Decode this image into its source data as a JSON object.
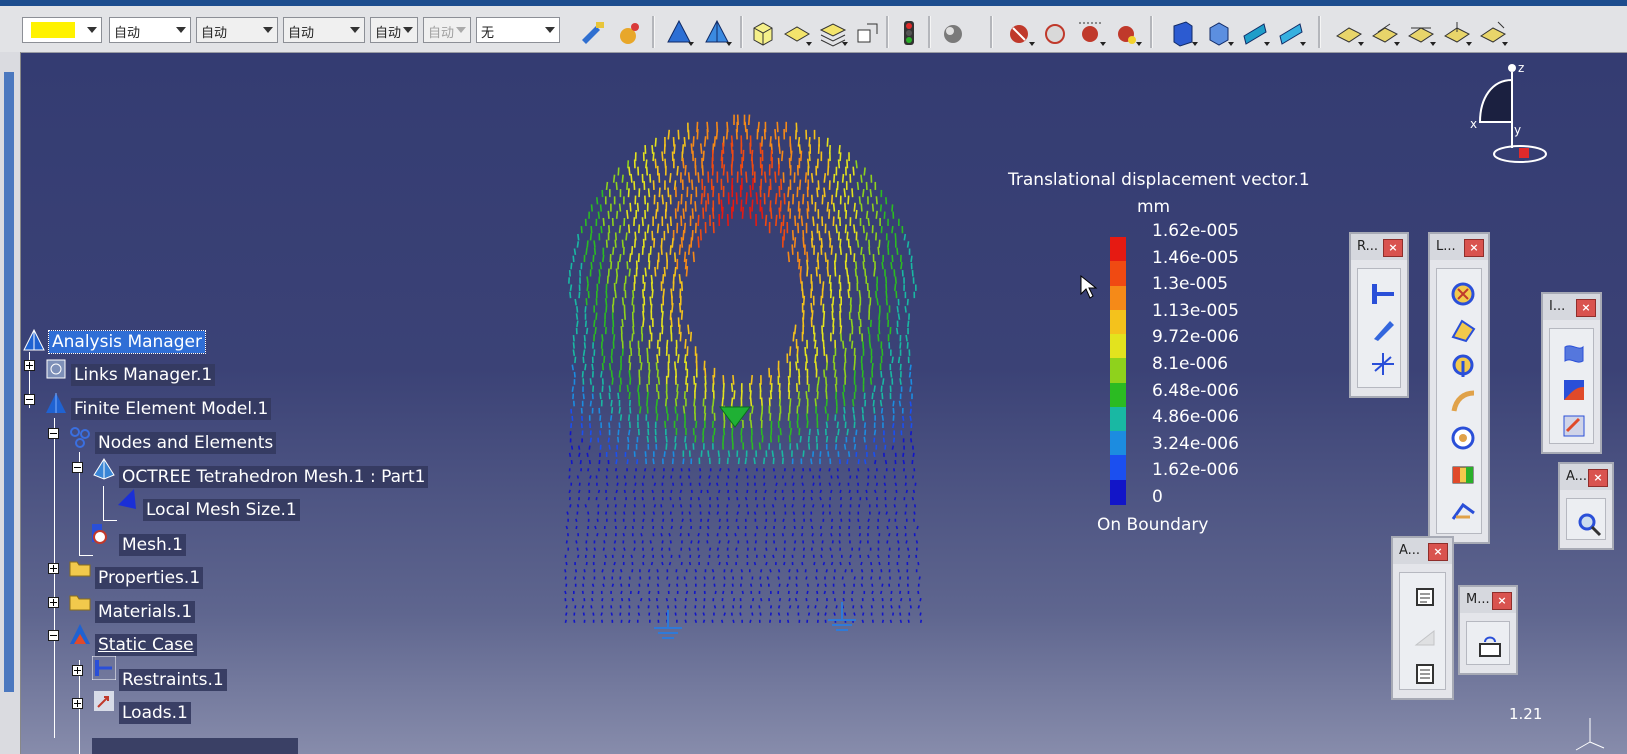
{
  "toolbar": {
    "combos": [
      {
        "label": "自动"
      },
      {
        "label": "自动"
      },
      {
        "label": "自动"
      },
      {
        "label": "自动"
      },
      {
        "label": "自动"
      },
      {
        "label": "无"
      }
    ],
    "color_swatch": "#fff200"
  },
  "tree": {
    "items": [
      {
        "label": "Analysis Manager"
      },
      {
        "label": "Links Manager.1"
      },
      {
        "label": "Finite Element Model.1"
      },
      {
        "label": "Nodes and Elements"
      },
      {
        "label": "OCTREE Tetrahedron Mesh.1 : Part1"
      },
      {
        "label": "Local Mesh Size.1"
      },
      {
        "label": "Mesh.1"
      },
      {
        "label": "Properties.1"
      },
      {
        "label": "Materials.1"
      },
      {
        "label": "Static Case"
      },
      {
        "label": "Restraints.1"
      },
      {
        "label": "Loads.1"
      }
    ]
  },
  "legend": {
    "title": "Translational displacement vector.1",
    "unit": "mm",
    "values": [
      "1.62e-005",
      "1.46e-005",
      "1.3e-005",
      "1.13e-005",
      "9.72e-006",
      "8.1e-006",
      "6.48e-006",
      "4.86e-006",
      "3.24e-006",
      "1.62e-006",
      "0"
    ],
    "colors": [
      "#e61a12",
      "#f04a12",
      "#f58a18",
      "#f4c21c",
      "#e3e31e",
      "#8fd21c",
      "#2bbb22",
      "#19b8a3",
      "#1c8ce0",
      "#1b4ff0",
      "#1215c8"
    ],
    "footer": "On Boundary"
  },
  "floating_toolbars": [
    {
      "title": "R...",
      "close": "×"
    },
    {
      "title": "L...",
      "close": "×"
    },
    {
      "title": "I...",
      "close": "×"
    },
    {
      "title": "A...",
      "close": "×"
    },
    {
      "title": "A...",
      "close": "×"
    },
    {
      "title": "M...",
      "close": "×"
    }
  ],
  "compass": {
    "z": "z",
    "x": "x",
    "y": "y"
  },
  "status": {
    "zoom": "1.21"
  }
}
